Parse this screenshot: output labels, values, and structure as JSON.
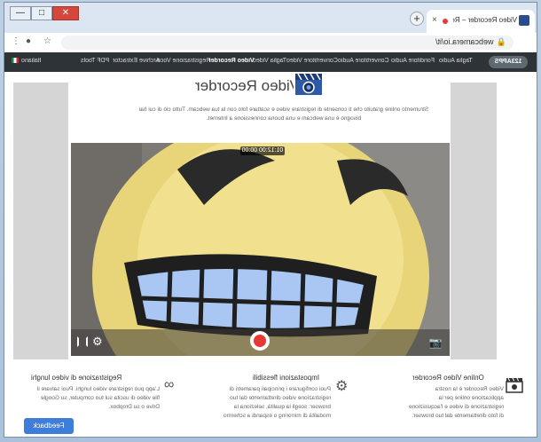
{
  "window": {
    "minimize_label": "—",
    "maximize_label": "□",
    "close_label": "✕"
  },
  "tab": {
    "title": "Video Recorder – Registra v",
    "close_label": "×"
  },
  "browser": {
    "new_tab_label": "+",
    "url": "webcamera.io/it/"
  },
  "site": {
    "logo": "123APPS",
    "language": "Italiano",
    "nav_items": [
      "Taglia Audio",
      "Fonditore Audio",
      "Convertitore Audio",
      "Convertitore Video",
      "Taglia Video",
      "Video Recorder",
      "Registrazione Voce",
      "Archive Extractor",
      "PDF Tools"
    ]
  },
  "hero": {
    "title": "Video Recorder",
    "description": "Strumento online gratuito che ti consente di registrare video e scattare foto con la tua webcam. Tutto ciò di cui hai bisogno è una webcam e una buona connessione a Internet."
  },
  "recorder": {
    "timer": "00:00",
    "timer_total": "01:12:00"
  },
  "features": [
    {
      "title": "Online Video Recorder",
      "text": "Video Recorder è la nostra applicazione online per la registrazione di video e l'acquisizione di foto direttamente dal tuo browser. Questa semplice app è dotata di impostazioni audio e video flessibili. Può elaborare rapidamente i"
    },
    {
      "title": "Impostazioni flessibili",
      "text": "Puoi configurare i principali parametri di registrazione video direttamente dal tuo browser: scegli la qualità, seleziona la modalità di mirroring o espandi a schermo intero. Puoi anche regolare il volume e ridurre l'effetto eco."
    },
    {
      "title": "Registrazione di video lunghi",
      "text": "L'app può registrare video lunghi. Puoi salvare il file video di uscita sul tuo computer, su Google Drive o su Dropbox."
    }
  ],
  "feedback": "Feedback"
}
